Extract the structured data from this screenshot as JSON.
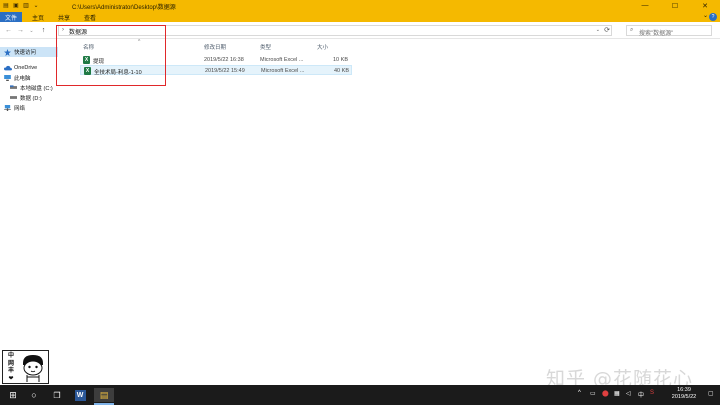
{
  "window": {
    "title_path": "C:\\Users\\Administrator\\Desktop\\数据源",
    "controls": {
      "minimize": "—",
      "maximize": "☐",
      "close": "✕"
    }
  },
  "ribbon": {
    "tabs": [
      {
        "label": "文件",
        "active": true
      },
      {
        "label": "主页",
        "active": false
      },
      {
        "label": "共享",
        "active": false
      },
      {
        "label": "查看",
        "active": false
      }
    ],
    "expand_glyph": "⌄",
    "help_glyph": "?"
  },
  "navigation": {
    "back": "←",
    "forward": "→",
    "recent": "⌄",
    "up": "↑",
    "breadcrumb_arrow": "›",
    "breadcrumb": "数据源",
    "dropdown": "⌄",
    "refresh": "⟳",
    "search_placeholder": "搜索\"数据源\""
  },
  "nav_pane": {
    "items": [
      {
        "label": "快速访问",
        "icon": "star-icon",
        "selected": true
      },
      {
        "label": "OneDrive",
        "icon": "cloud-icon",
        "selected": false
      },
      {
        "label": "此电脑",
        "icon": "computer-icon",
        "selected": false
      },
      {
        "label": "本地磁盘 (C:)",
        "icon": "drive-icon",
        "selected": false
      },
      {
        "label": "数据 (D:)",
        "icon": "drive-icon",
        "selected": false
      },
      {
        "label": "网络",
        "icon": "network-icon",
        "selected": false
      }
    ]
  },
  "file_list": {
    "columns": {
      "name": "名称",
      "modified": "修改日期",
      "type": "类型",
      "size": "大小"
    },
    "sort_glyph": "^",
    "rows": [
      {
        "name": "提现",
        "modified": "2019/5/22 16:38",
        "type": "Microsoft Excel ...",
        "size": "10 KB",
        "icon_letter": "X"
      },
      {
        "name": "全技术局-利息-1-10",
        "modified": "2019/5/22 15:49",
        "type": "Microsoft Excel ...",
        "size": "40 KB",
        "icon_letter": "X"
      }
    ]
  },
  "sticker": {
    "chars": [
      "中",
      "网",
      "丰",
      "❤"
    ]
  },
  "watermark": "知乎 @花随花心",
  "taskbar": {
    "start": "⊞",
    "search": "○",
    "taskview": "❐",
    "word": "W",
    "explorer": "▤",
    "tray": {
      "chevron": "^",
      "ime": "中",
      "clock_time": "16:39",
      "clock_date": "2019/5/22"
    }
  },
  "colors": {
    "accent_yellow": "#f5b900",
    "tab_active_blue": "#2b6fc4",
    "highlight_red": "#e0282a",
    "excel_green": "#1f7a45",
    "taskbar": "#1b1b1b"
  }
}
